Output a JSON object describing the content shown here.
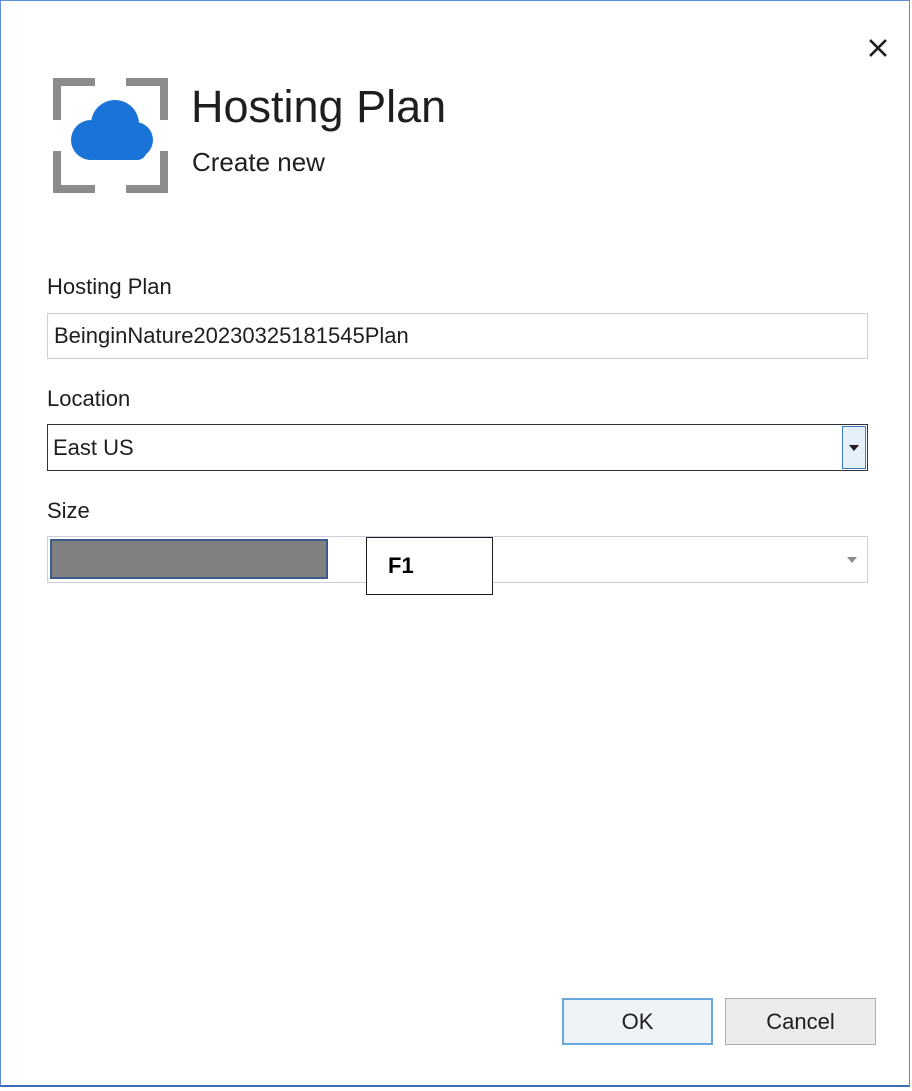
{
  "dialog": {
    "title": "Hosting Plan",
    "subtitle": "Create new",
    "icon": "azure-app-service-cloud-icon",
    "close_icon": "close-icon"
  },
  "fields": {
    "hosting_plan": {
      "label": "Hosting Plan",
      "value": "BeinginNature20230325181545Plan"
    },
    "location": {
      "label": "Location",
      "value": "East US"
    },
    "size": {
      "label": "Size",
      "value": "",
      "callout": "F1"
    }
  },
  "buttons": {
    "ok": "OK",
    "cancel": "Cancel"
  },
  "colors": {
    "cloud": "#1a73d6",
    "frame": "#8c8c8c",
    "dialog_border": "#5b8ed6",
    "ok_border": "#6aa6de"
  }
}
